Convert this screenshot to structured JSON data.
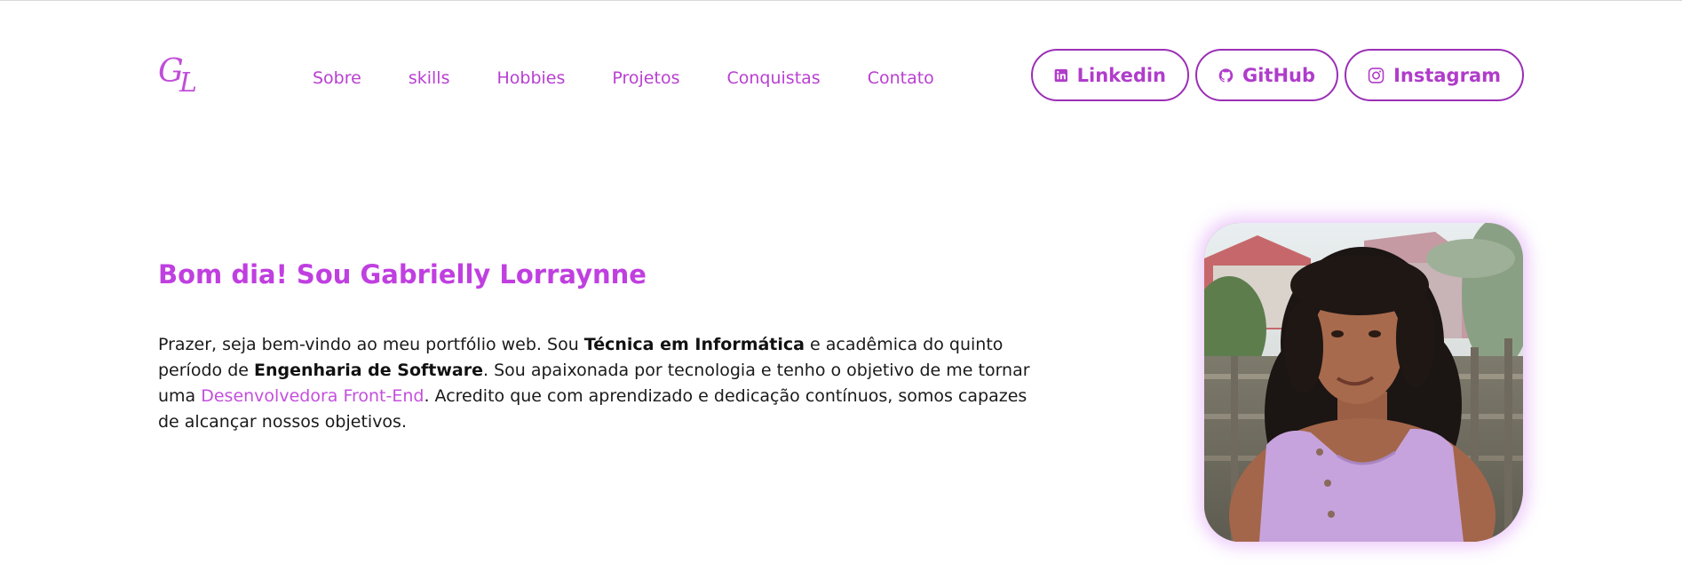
{
  "logo": {
    "letter1": "G",
    "letter2": "L"
  },
  "nav": {
    "items": [
      "Sobre",
      "skills",
      "Hobbies",
      "Projetos",
      "Conquistas",
      "Contato"
    ]
  },
  "social": {
    "linkedin": {
      "label": "Linkedin",
      "icon": "linkedin-icon"
    },
    "github": {
      "label": "GitHub",
      "icon": "github-icon"
    },
    "instagram": {
      "label": "Instagram",
      "icon": "instagram-icon"
    }
  },
  "hero": {
    "title": "Bom dia! Sou Gabrielly Lorraynne",
    "intro": {
      "part1": "Prazer, seja bem-vindo ao meu portfólio web. Sou ",
      "bold1": "Técnica em Informática",
      "part2": " e acadêmica do quinto período de ",
      "bold2": "Engenharia de Software",
      "part3": ". Sou apaixonada por tecnologia e tenho o objetivo de me tornar uma ",
      "accent": "Desenvolvedora Front-End",
      "part4": ". Acredito que com aprendizado e dedicação contínuos, somos capazes de alcançar nossos objetivos."
    }
  },
  "colors": {
    "accent": "#c03fe0",
    "button_border": "#9b2fb6",
    "text": "#1a1a1a"
  }
}
